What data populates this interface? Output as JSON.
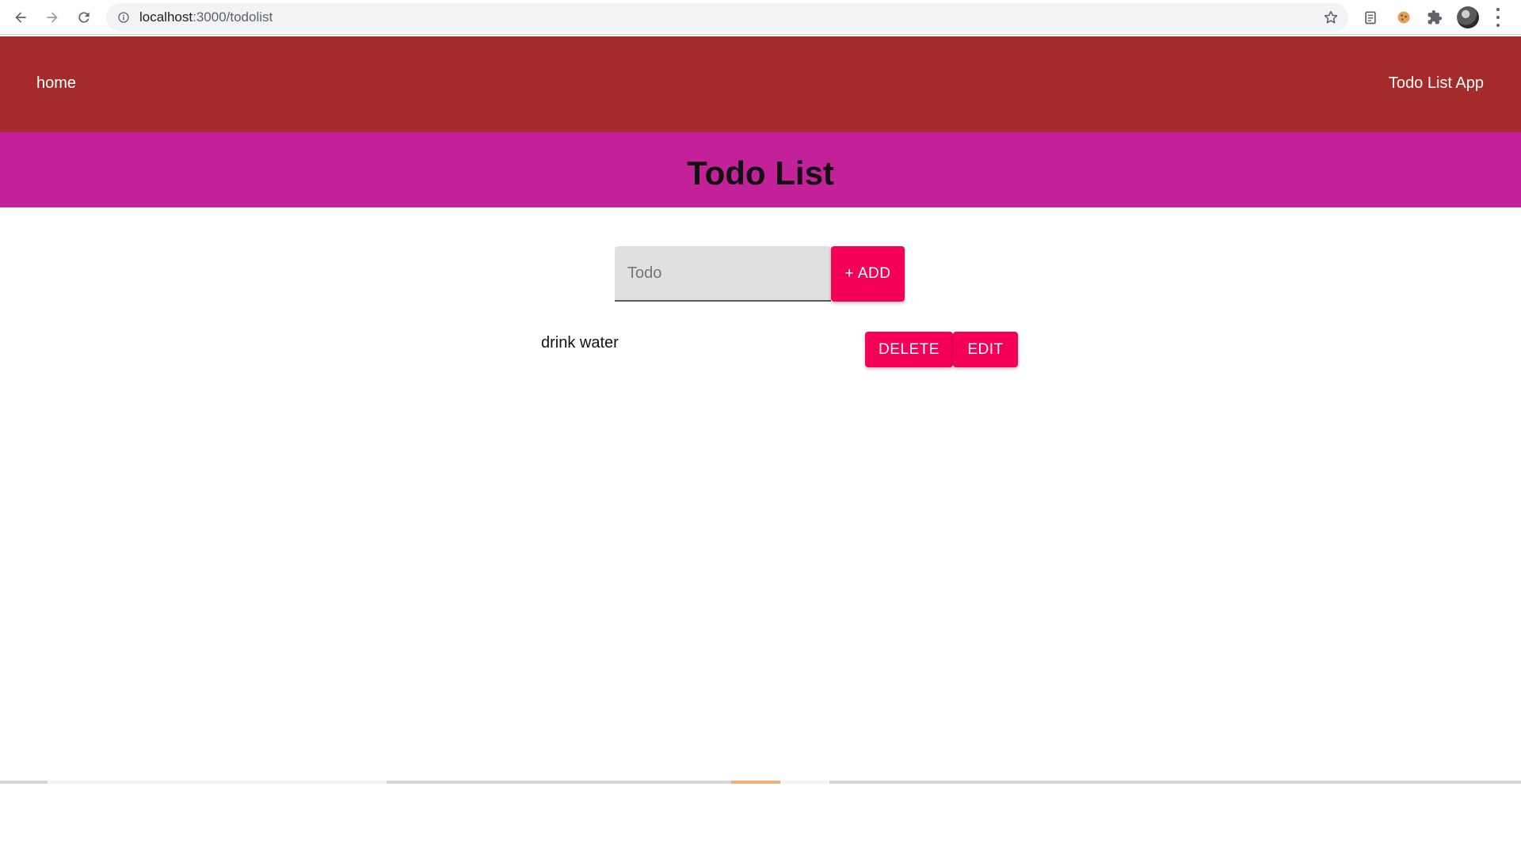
{
  "browser": {
    "url_host": "localhost",
    "url_path": ":3000/todolist"
  },
  "header": {
    "home_label": "home",
    "app_name": "Todo List App"
  },
  "page": {
    "title": "Todo List"
  },
  "form": {
    "input_placeholder": "Todo",
    "input_value": "",
    "add_label": "+ ADD"
  },
  "todos": [
    {
      "text": "drink water",
      "delete_label": "DELETE",
      "edit_label": "EDIT"
    }
  ],
  "colors": {
    "header_bg": "#a52a2a",
    "title_band_bg": "#c2219a",
    "button_accent": "#f50057"
  },
  "icons": {
    "back": "arrow-left-icon",
    "forward": "arrow-right-icon",
    "reload": "reload-icon",
    "info": "info-icon",
    "star": "star-icon",
    "clipboard_ext": "clipboard-icon",
    "cookie_ext": "cookie-icon",
    "extensions": "puzzle-icon",
    "menu": "more-vert-icon"
  }
}
